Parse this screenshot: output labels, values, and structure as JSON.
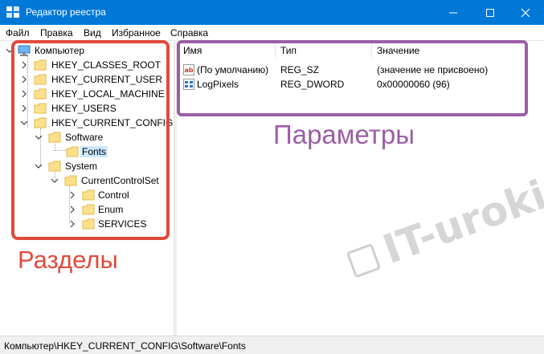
{
  "window": {
    "title": "Редактор реестра",
    "accent_color": "#0078d7",
    "icon": "registry-editor-icon"
  },
  "menu": [
    "Файл",
    "Правка",
    "Вид",
    "Избранное",
    "Справка"
  ],
  "tree": {
    "root": "Компьютер",
    "hives": [
      "HKEY_CLASSES_ROOT",
      "HKEY_CURRENT_USER",
      "HKEY_LOCAL_MACHINE",
      "HKEY_USERS",
      "HKEY_CURRENT_CONFIG"
    ],
    "software": "Software",
    "fonts": "Fonts",
    "system": "System",
    "current_control_set": "CurrentControlSet",
    "ccs_children": [
      "Control",
      "Enum",
      "SERVICES"
    ],
    "selected": "Fonts"
  },
  "list": {
    "columns": [
      "Имя",
      "Тип",
      "Значение"
    ],
    "rows": [
      {
        "name": "(По умолчанию)",
        "type": "REG_SZ",
        "value": "(значение не присвоено)",
        "icon": "string-value-icon"
      },
      {
        "name": "LogPixels",
        "type": "REG_DWORD",
        "value": "0x00000060 (96)",
        "icon": "binary-value-icon"
      }
    ]
  },
  "status": {
    "path": "Компьютер\\HKEY_CURRENT_CONFIG\\Software\\Fonts"
  },
  "annotations": {
    "sections_label": "Разделы",
    "parameters_label": "Параметры",
    "sections_color": "#e04a3c",
    "parameters_color": "#9b5fa6"
  },
  "watermark": "IT-uroki.ru"
}
